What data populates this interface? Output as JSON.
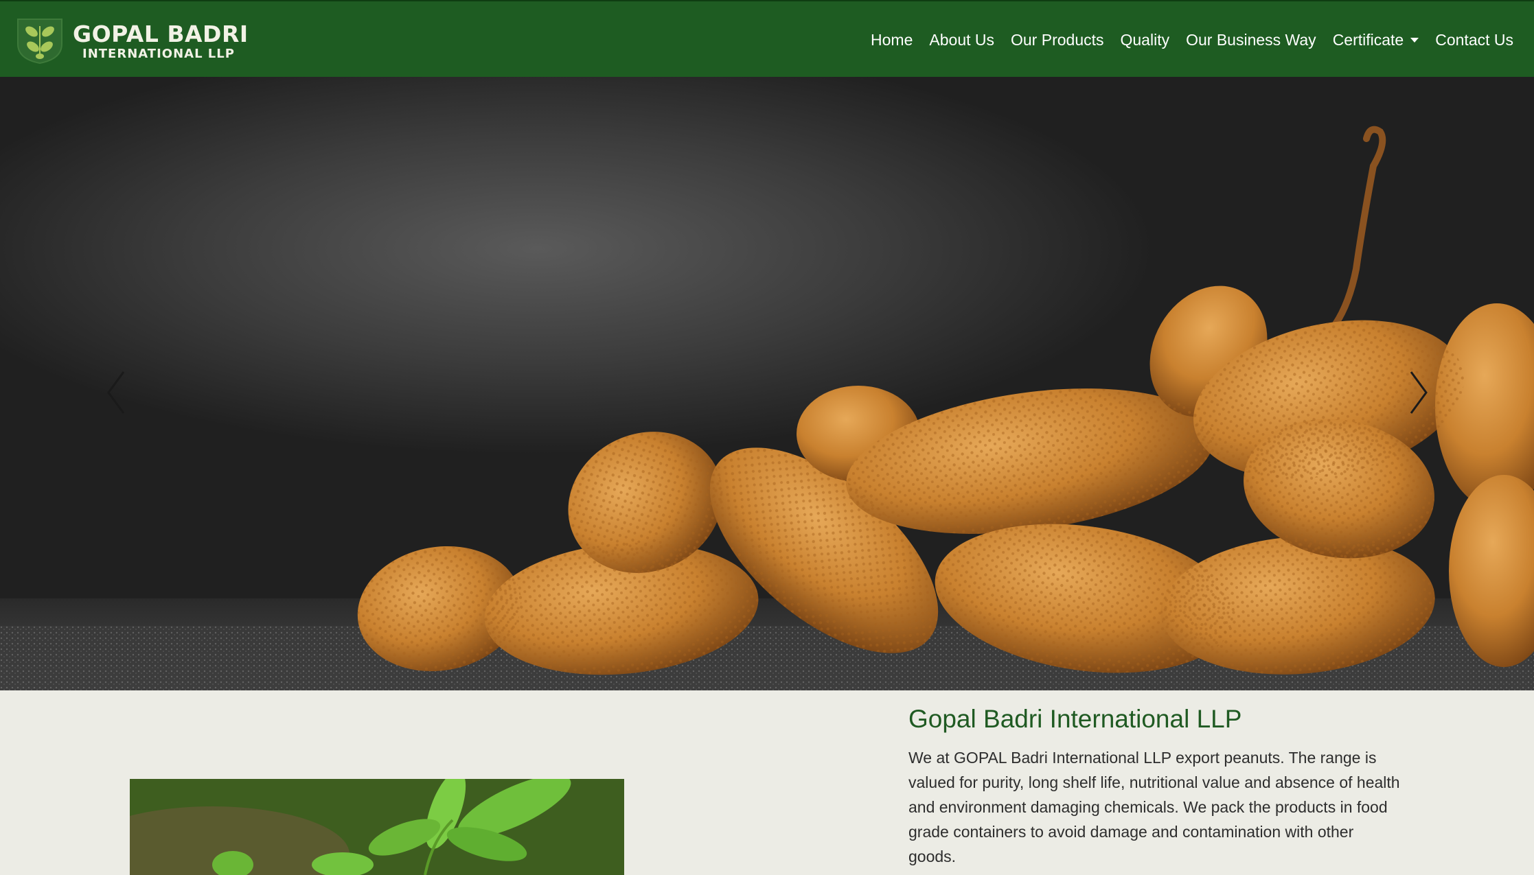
{
  "brand": {
    "name": "GOPAL BADRI",
    "subtitle": "INTERNATIONAL LLP",
    "logo_icon": "leaf-shield-icon"
  },
  "nav": {
    "items": [
      {
        "label": "Home"
      },
      {
        "label": "About Us"
      },
      {
        "label": "Our Products"
      },
      {
        "label": "Quality"
      },
      {
        "label": "Our Business Way"
      },
      {
        "label": "Certificate",
        "dropdown": true
      },
      {
        "label": "Contact Us"
      }
    ]
  },
  "hero": {
    "image": "peanuts-photo",
    "prev_icon": "chevron-left-icon",
    "next_icon": "chevron-right-icon"
  },
  "about": {
    "title": "Gopal Badri International LLP",
    "text": "We at GOPAL Badri International LLP export peanuts. The range is valued for purity, long shelf life, nutritional value and absence of health and environment damaging chemicals. We pack the products in food grade containers to avoid damage and contamination with other goods.",
    "image": "peanut-plant-photo"
  },
  "colors": {
    "navbar_bg": "#1e5c22",
    "title_green": "#1f5a22",
    "page_bg": "#ecece5"
  }
}
